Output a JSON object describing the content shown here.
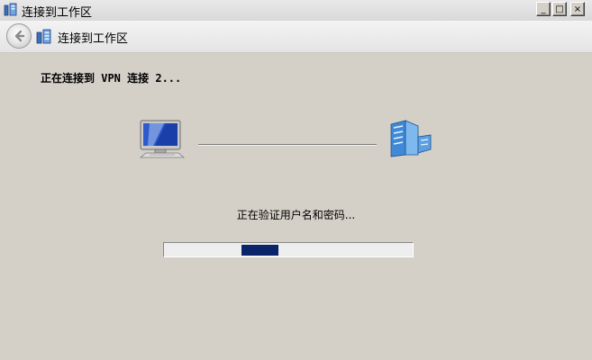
{
  "window": {
    "title": "连接到工作区",
    "minimize": "_",
    "maximize": "□",
    "close": "×"
  },
  "nav": {
    "title": "连接到工作区"
  },
  "main": {
    "heading": "正在连接到 VPN 连接 2...",
    "status_message": "正在验证用户名和密码...",
    "progress": {
      "start_fraction": 0.31,
      "end_fraction": 0.46
    }
  },
  "colors": {
    "progress_fill": "#0a246a",
    "window_background": "#d4d0c8"
  },
  "icons": {
    "title": "network-workplace-icon",
    "back": "back-arrow-icon",
    "nav": "network-workplace-icon",
    "client": "computer-icon",
    "server": "server-icon"
  }
}
